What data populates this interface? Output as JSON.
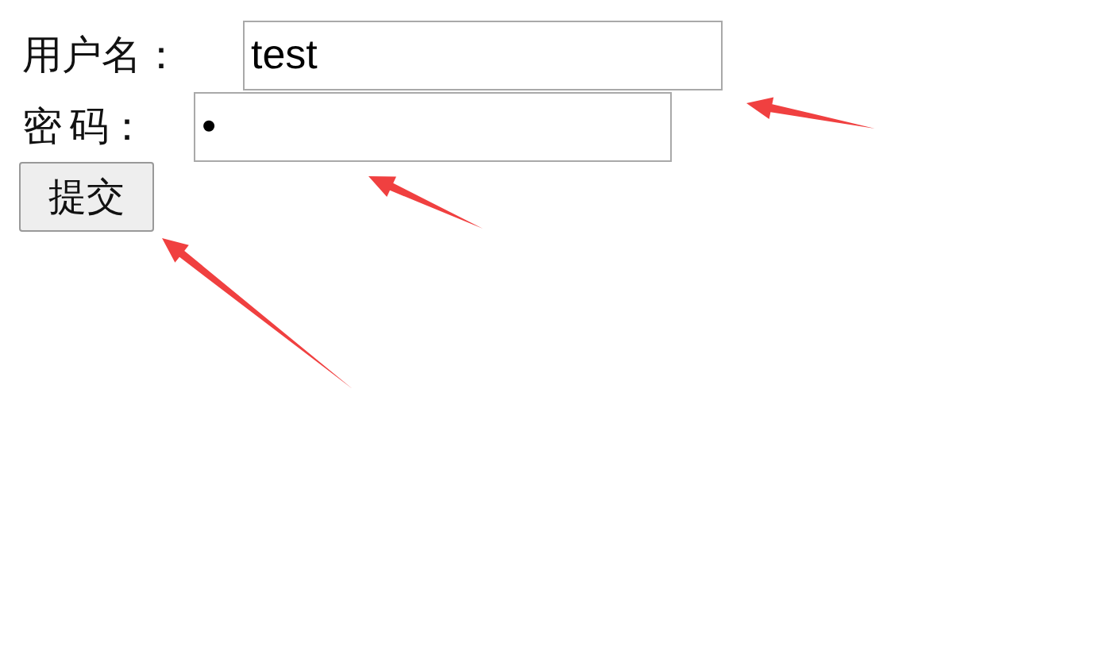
{
  "form": {
    "fields": [
      {
        "label": "用户名：",
        "value": "test",
        "kind": "username"
      },
      {
        "label": "密 码：",
        "value": "•",
        "kind": "password"
      }
    ],
    "submit": "提交"
  }
}
